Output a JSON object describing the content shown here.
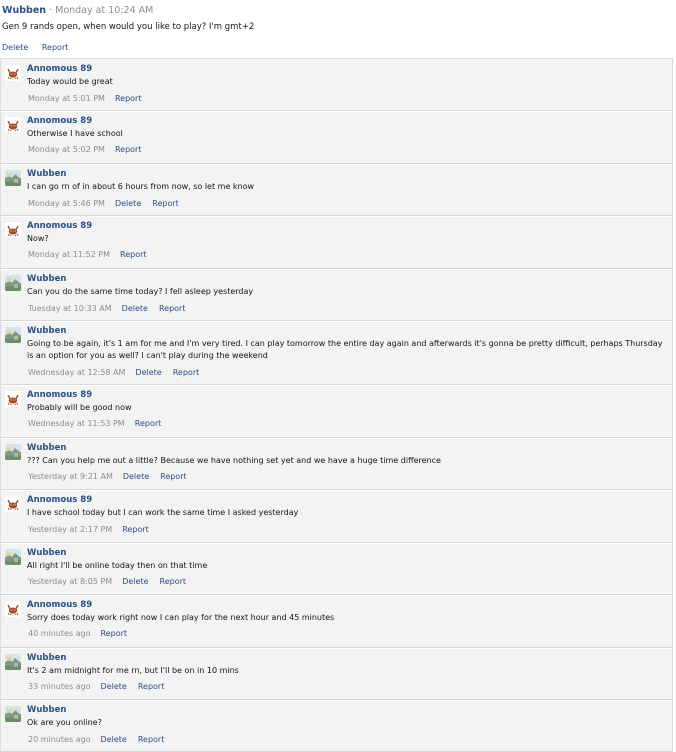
{
  "post": {
    "author": "Wubben",
    "separator": "·",
    "time": "Monday at 10:24 AM",
    "text": "Gen 9 rands open, when would you like to play? I'm gmt+2",
    "delete_label": "Delete",
    "report_label": "Report"
  },
  "comments": [
    {
      "author": "Annomous 89",
      "avatar": "crab-avatar",
      "text": "Today would be great",
      "time": "Monday at 5:01 PM",
      "delete": "",
      "report": "Report"
    },
    {
      "author": "Annomous 89",
      "avatar": "crab-avatar",
      "text": "Otherwise I have school",
      "time": "Monday at 5:02 PM",
      "delete": "",
      "report": "Report"
    },
    {
      "author": "Wubben",
      "avatar": "landscape-avatar",
      "text": "I can go rn of in about 6 hours from now, so let me know",
      "time": "Monday at 5:46 PM",
      "delete": "Delete",
      "report": "Report"
    },
    {
      "author": "Annomous 89",
      "avatar": "crab-avatar",
      "text": "Now?",
      "time": "Monday at 11:52 PM",
      "delete": "",
      "report": "Report"
    },
    {
      "author": "Wubben",
      "avatar": "landscape-avatar",
      "text": "Can you do the same time today? I fell asleep yesterday",
      "time": "Tuesday at 10:33 AM",
      "delete": "Delete",
      "report": "Report"
    },
    {
      "author": "Wubben",
      "avatar": "landscape-avatar",
      "text": "Going to be again, it's 1 am for me and I'm very tired. I can play tomorrow the entire day again and afterwards it's gonna be pretty difficult, perhaps Thursday is an option for you as well? I can't play during the weekend",
      "time": "Wednesday at 12:58 AM",
      "delete": "Delete",
      "report": "Report"
    },
    {
      "author": "Annomous 89",
      "avatar": "crab-avatar",
      "text": "Probably will be good now",
      "time": "Wednesday at 11:53 PM",
      "delete": "",
      "report": "Report"
    },
    {
      "author": "Wubben",
      "avatar": "landscape-avatar",
      "text": "??? Can you help me out a little? Because we have nothing set yet and we have a huge time difference",
      "time": "Yesterday at 9:21 AM",
      "delete": "Delete",
      "report": "Report"
    },
    {
      "author": "Annomous 89",
      "avatar": "crab-avatar",
      "text": "I have school today but I can work the same time I asked yesterday",
      "time": "Yesterday at 2:17 PM",
      "delete": "",
      "report": "Report"
    },
    {
      "author": "Wubben",
      "avatar": "landscape-avatar",
      "text": "All right I'll be online today then on that time",
      "time": "Yesterday at 8:05 PM",
      "delete": "Delete",
      "report": "Report"
    },
    {
      "author": "Annomous 89",
      "avatar": "crab-avatar",
      "text": "Sorry does today work right now I can play for the next hour and 45 minutes",
      "time": "40 minutes ago",
      "delete": "",
      "report": "Report"
    },
    {
      "author": "Wubben",
      "avatar": "landscape-avatar",
      "text": "It's 2 am midnight for me rn, but I'll be on in 10 mins",
      "time": "33 minutes ago",
      "delete": "Delete",
      "report": "Report"
    },
    {
      "author": "Wubben",
      "avatar": "landscape-avatar",
      "text": "Ok are you online?",
      "time": "20 minutes ago",
      "delete": "Delete",
      "report": "Report"
    }
  ]
}
